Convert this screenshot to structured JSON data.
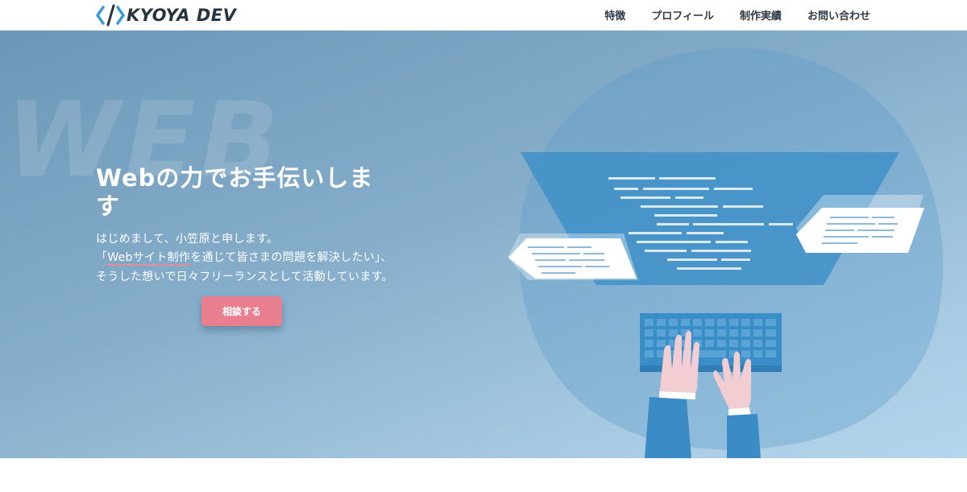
{
  "header": {
    "logo_text": "KYOYA DEV",
    "nav": [
      "特徴",
      "プロフィール",
      "制作実績",
      "お問い合わせ"
    ]
  },
  "hero": {
    "watermark": "WEB",
    "title": "Webの力でお手伝いします",
    "lead_1": "はじめまして、小笠原と申します。",
    "lead_2a": "「",
    "lead_2b": "Webサイト制作",
    "lead_2c": "を通じて皆さまの問題を解決したい」、そうした想いで日々フリーランスとして活動しています。",
    "cta_label": "相談する"
  },
  "colors": {
    "hero_top": "#6b97b7",
    "hero_bottom": "#b4d6ec",
    "cta": "#e87f8f",
    "logo_accent": "#3a9ad9",
    "text_dark": "#2e3944"
  },
  "icons": [
    "code-bracket-logo-icon",
    "web-coding-illustration"
  ]
}
